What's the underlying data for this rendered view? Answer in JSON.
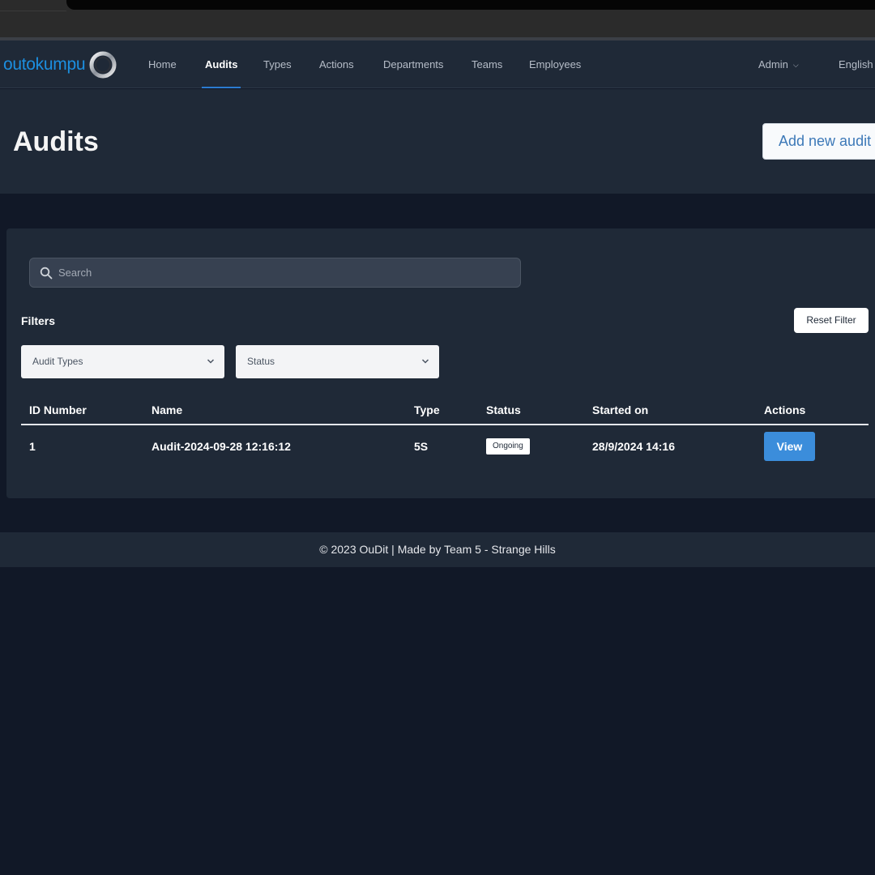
{
  "brand": {
    "logo_text": "outokumpu"
  },
  "nav": {
    "items": [
      {
        "label": "Home",
        "active": false
      },
      {
        "label": "Audits",
        "active": true
      },
      {
        "label": "Types",
        "active": false
      },
      {
        "label": "Actions",
        "active": false
      },
      {
        "label": "Departments",
        "active": false
      },
      {
        "label": "Teams",
        "active": false
      },
      {
        "label": "Employees",
        "active": false
      }
    ],
    "user_menu": "Admin",
    "language": "English"
  },
  "header": {
    "title": "Audits",
    "add_button": "Add new audit"
  },
  "search": {
    "placeholder": "Search",
    "value": ""
  },
  "filters": {
    "label": "Filters",
    "reset_button": "Reset Filter",
    "audit_types": "Audit Types",
    "status": "Status"
  },
  "table": {
    "columns": [
      "ID Number",
      "Name",
      "Type",
      "Status",
      "Started on",
      "Actions"
    ],
    "rows": [
      {
        "id": "1",
        "name": "Audit-2024-09-28 12:16:12",
        "type": "5S",
        "status": "Ongoing",
        "started_on": "28/9/2024 14:16",
        "action": "View"
      }
    ]
  },
  "footer": {
    "text": "© 2023 OuDit | Made by Team 5 - Strange Hills"
  },
  "colors": {
    "background": "#111827",
    "panel": "#1f2937",
    "accent": "#3b8ddb",
    "brand": "#1c8fe0"
  }
}
